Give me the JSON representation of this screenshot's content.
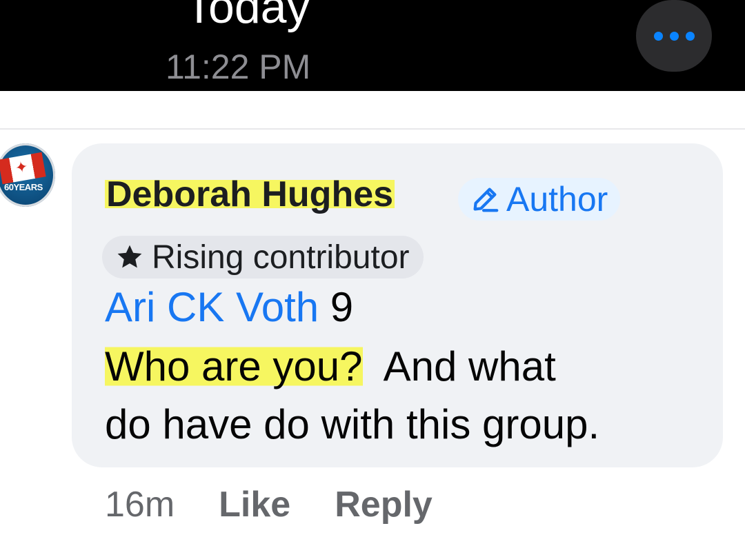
{
  "header": {
    "title": "Today",
    "time": "11:22 PM",
    "more_icon": "more-horizontal-icon",
    "accent": "#0a84ff"
  },
  "comment": {
    "avatar": {
      "icon": "avatar-canada-flag",
      "badge_text": "60YEARS"
    },
    "author_name": "Deborah Hughes",
    "author_badge": "Author",
    "author_badge_icon": "pencil-icon",
    "contributor_badge": "Rising contributor",
    "contributor_badge_icon": "star-icon",
    "mention": "Ari CK Voth",
    "mention_suffix": " 9",
    "highlighted_text": "Who are you?",
    "text_line1_rest": "  And what",
    "text_line2": "do have do with this group.",
    "highlight_color": "#f6f660",
    "link_color": "#1877f2"
  },
  "actions": {
    "timestamp": "16m",
    "like_label": "Like",
    "reply_label": "Reply"
  }
}
